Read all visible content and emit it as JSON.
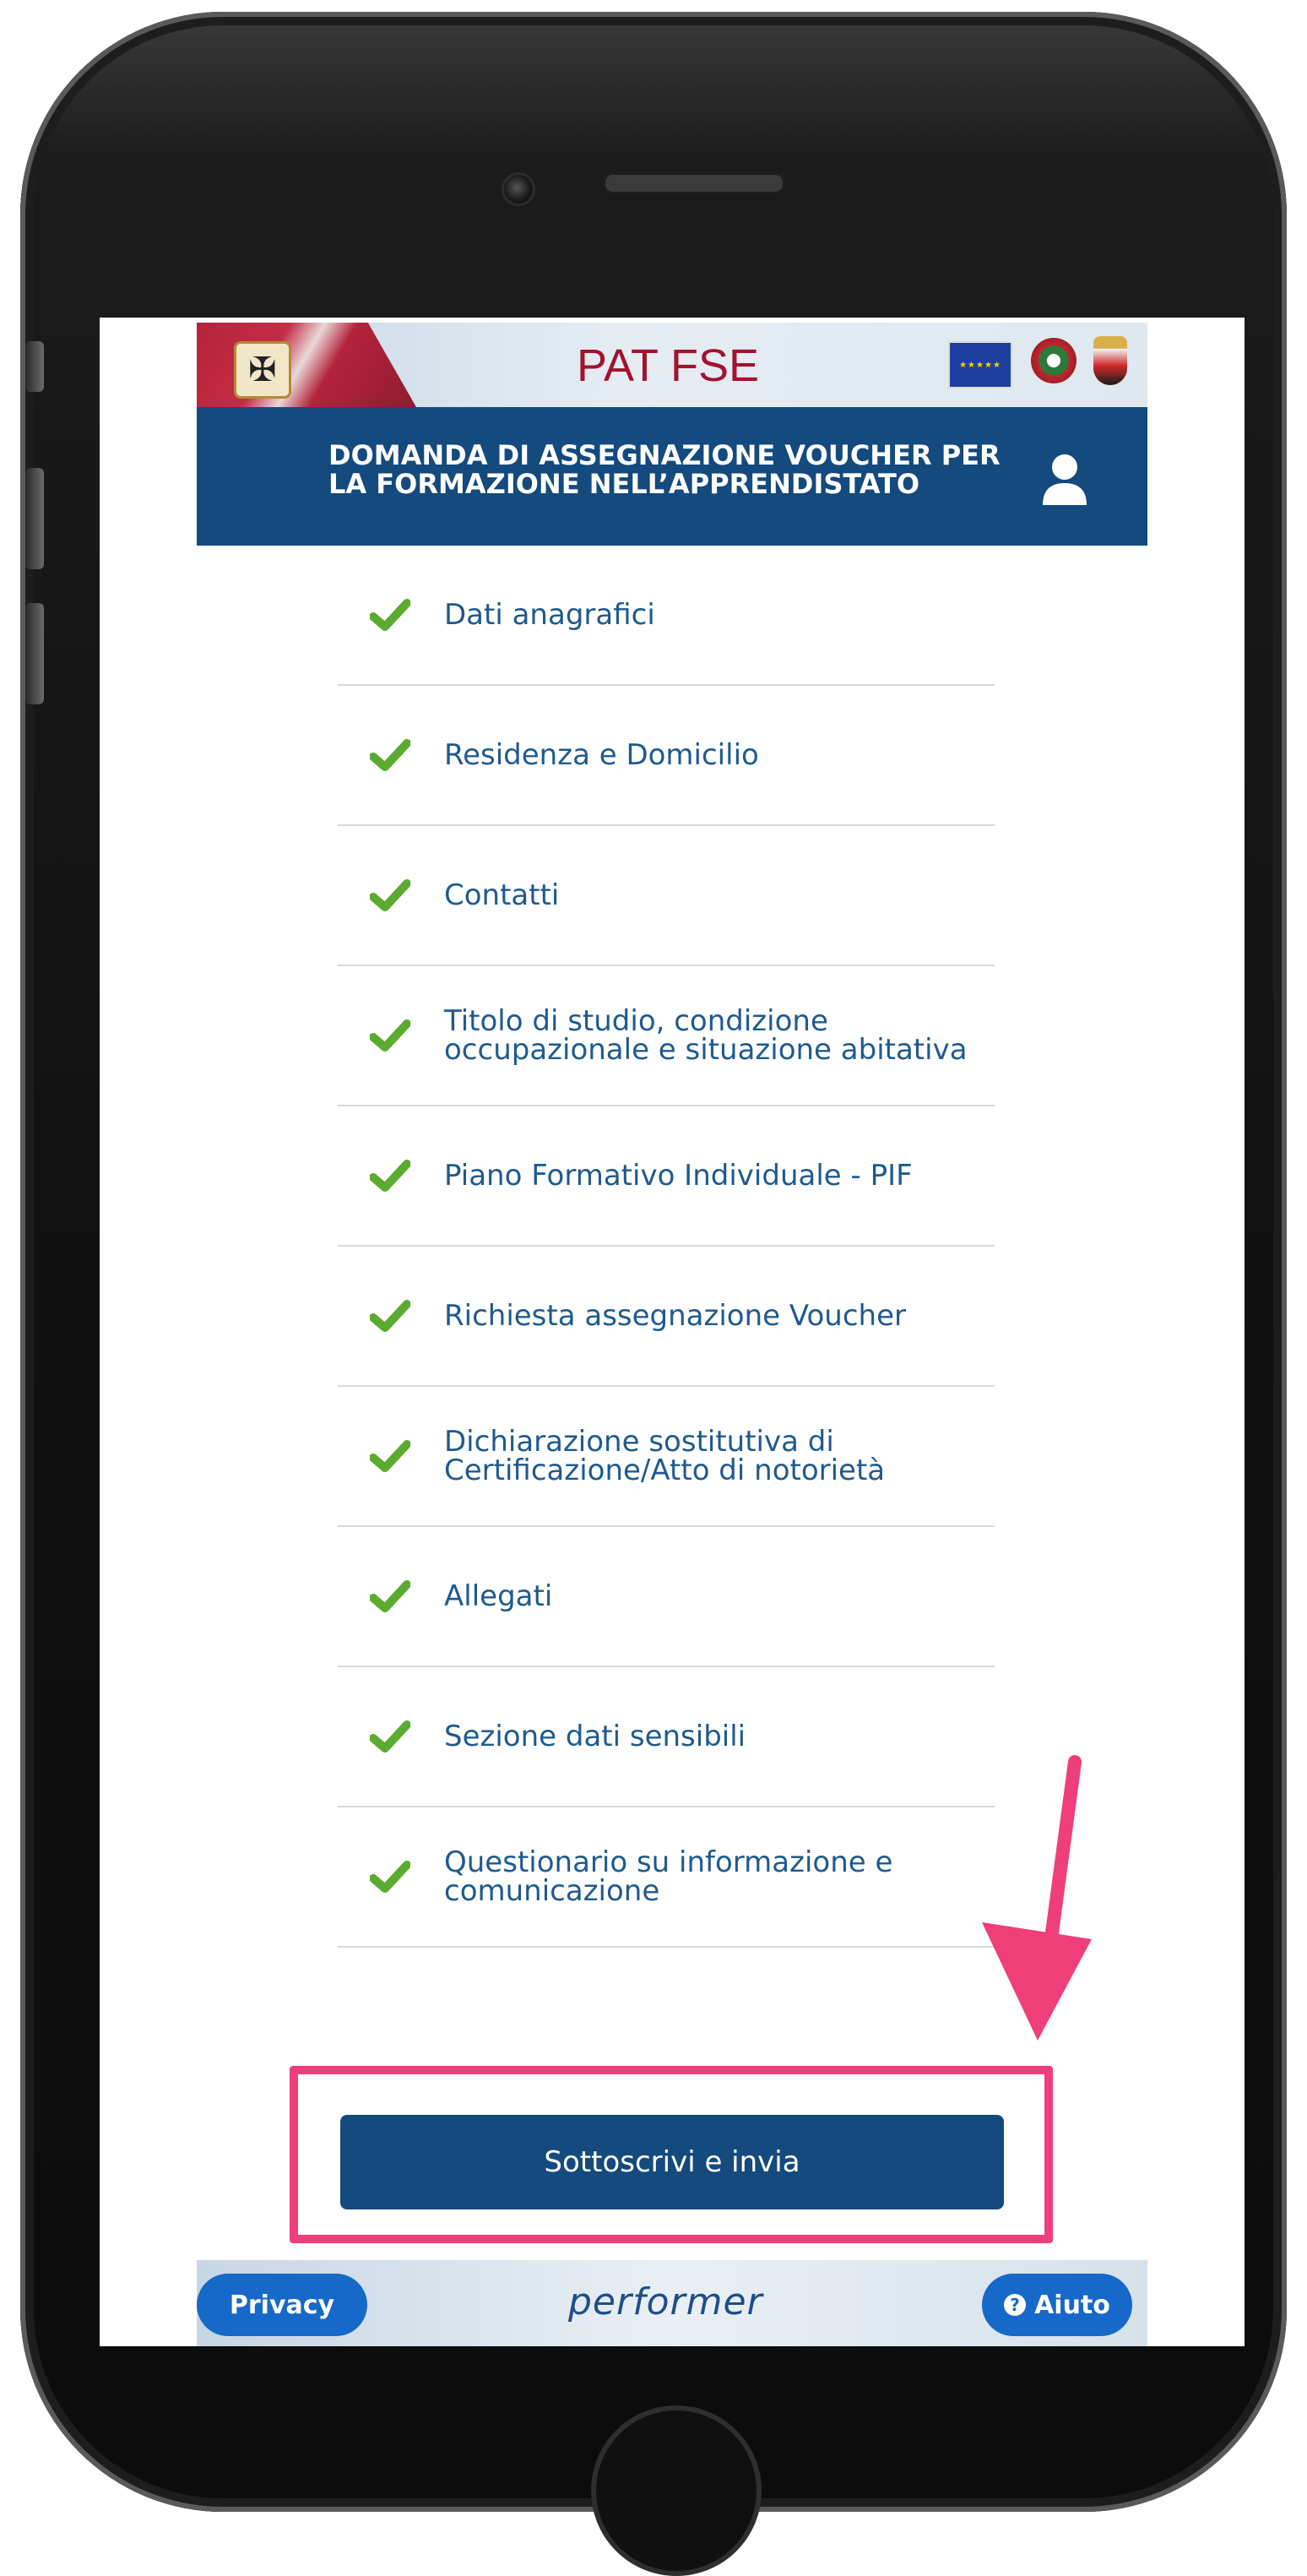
{
  "app": {
    "brand_title": "PAT FSE",
    "header_title": "DOMANDA DI ASSEGNAZIONE VOUCHER PER LA FORMAZIONE NELL’APPRENDISTATO"
  },
  "steps": [
    {
      "label": "Dati anagrafici",
      "status": "complete"
    },
    {
      "label": "Residenza e Domicilio",
      "status": "complete"
    },
    {
      "label": "Contatti",
      "status": "complete"
    },
    {
      "label": "Titolo di studio, condizione\noccupazionale e situazione abitativa",
      "status": "complete"
    },
    {
      "label": "Piano Formativo Individuale - PIF",
      "status": "complete"
    },
    {
      "label": "Richiesta assegnazione Voucher",
      "status": "complete"
    },
    {
      "label": "Dichiarazione sostitutiva di\nCertificazione/Atto di notorietà",
      "status": "complete"
    },
    {
      "label": "Allegati",
      "status": "complete"
    },
    {
      "label": "Sezione dati sensibili",
      "status": "complete"
    },
    {
      "label": "Questionario su informazione e\ncomunicazione",
      "status": "complete"
    }
  ],
  "actions": {
    "submit_label": "Sottoscrivi e invia"
  },
  "footer": {
    "privacy_label": "Privacy",
    "brand": "performer",
    "help_label": "Aiuto"
  },
  "icons": {
    "check": "check-icon",
    "user": "user-icon",
    "help": "question-circle-icon"
  },
  "colors": {
    "header_bg": "#144a7d",
    "check": "#5aab2f",
    "link_text": "#1f5a8f",
    "highlight": "#ee3f78",
    "pill": "#1668c9",
    "brand_title": "#a3122f"
  }
}
